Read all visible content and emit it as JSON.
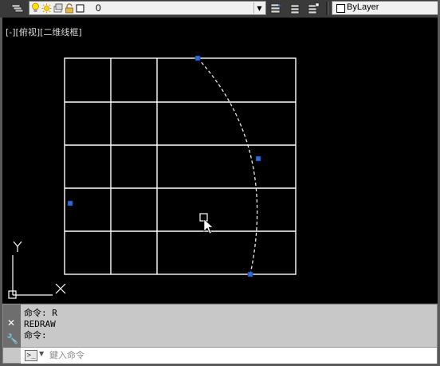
{
  "toolbar": {
    "layer_manager_icon": "layer-stack-icon",
    "layer_state_icons": [
      "lightbulb-icon",
      "sun-icon",
      "layer-icon",
      "lock-icon",
      "square-icon"
    ],
    "layer_value": "0",
    "layer_tool_icons": [
      "make-current-icon",
      "layer-previous-icon",
      "layer-states-icon"
    ],
    "color_value": "ByLayer",
    "color_swatch": "#ffffff"
  },
  "viewport": {
    "label": "[-][俯视][二维线框]",
    "background": "#000000",
    "grid_color": "#ffffff",
    "grip_color": "#2a6edb",
    "ucs_y_label": "Y",
    "ucs_x_label": "X"
  },
  "command": {
    "history": [
      "命令: R",
      "REDRAW",
      "命令:"
    ],
    "input_placeholder": "鍵入命令",
    "input_value": ""
  }
}
